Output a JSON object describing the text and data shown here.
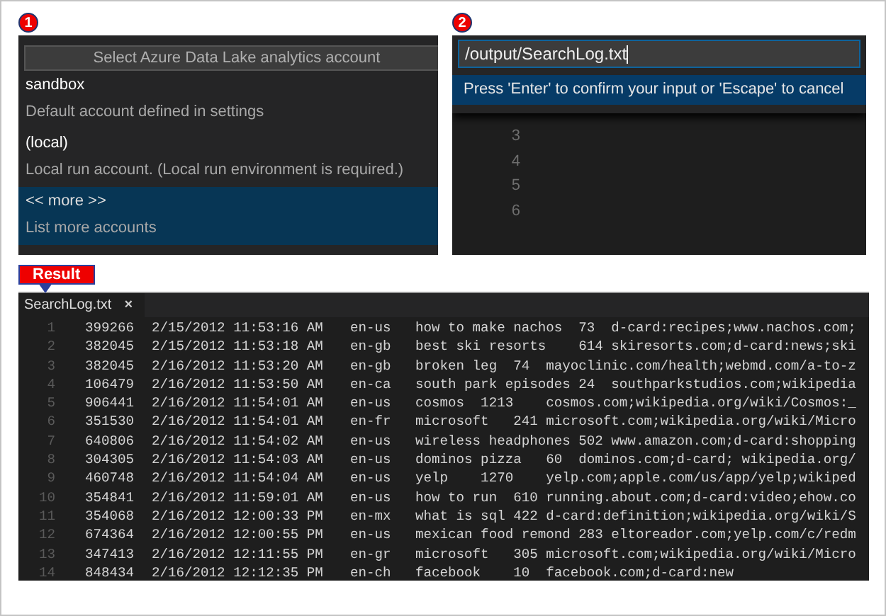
{
  "account_picker": {
    "badge": "1",
    "placeholder": "Select Azure Data Lake analytics account",
    "items": [
      {
        "name": "sandbox",
        "description": "Default account defined in settings",
        "selected": false
      },
      {
        "name": "(local)",
        "description": "Local run account. (Local run environment is required.)",
        "selected": false
      },
      {
        "name": "<< more >>",
        "description": "List more accounts",
        "selected": true
      }
    ]
  },
  "output_prompt": {
    "badge": "2",
    "value": "/output/SearchLog.txt",
    "message": "Press 'Enter' to confirm your input or 'Escape' to cancel",
    "line_numbers": [
      "3",
      "4",
      "5",
      "6"
    ]
  },
  "result": {
    "label": "Result",
    "tab": {
      "title": "SearchLog.txt",
      "close": "×"
    },
    "rows": [
      {
        "line": "1",
        "id": "399266",
        "time": "2/15/2012 11:53:16 AM",
        "locale": "en-us",
        "rest": "how to make nachos  73  d-card:recipes;www.nachos.com;"
      },
      {
        "line": "2",
        "id": "382045",
        "time": "2/15/2012 11:53:18 AM",
        "locale": "en-gb",
        "rest": "best ski resorts    614 skiresorts.com;d-card:news;ski"
      },
      {
        "line": "3",
        "id": "382045",
        "time": "2/16/2012 11:53:20 AM",
        "locale": "en-gb",
        "rest": "broken leg  74  mayoclinic.com/health;webmd.com/a-to-z"
      },
      {
        "line": "4",
        "id": "106479",
        "time": "2/16/2012 11:53:50 AM",
        "locale": "en-ca",
        "rest": "south park episodes 24  southparkstudios.com;wikipedia"
      },
      {
        "line": "5",
        "id": "906441",
        "time": "2/16/2012 11:54:01 AM",
        "locale": "en-us",
        "rest": "cosmos  1213    cosmos.com;wikipedia.org/wiki/Cosmos:_"
      },
      {
        "line": "6",
        "id": "351530",
        "time": "2/16/2012 11:54:01 AM",
        "locale": "en-fr",
        "rest": "microsoft   241 microsoft.com;wikipedia.org/wiki/Micro"
      },
      {
        "line": "7",
        "id": "640806",
        "time": "2/16/2012 11:54:02 AM",
        "locale": "en-us",
        "rest": "wireless headphones 502 www.amazon.com;d-card:shopping"
      },
      {
        "line": "8",
        "id": "304305",
        "time": "2/16/2012 11:54:03 AM",
        "locale": "en-us",
        "rest": "dominos pizza   60  dominos.com;d-card; wikipedia.org/"
      },
      {
        "line": "9",
        "id": "460748",
        "time": "2/16/2012 11:54:04 AM",
        "locale": "en-us",
        "rest": "yelp    1270    yelp.com;apple.com/us/app/yelp;wikiped"
      },
      {
        "line": "10",
        "id": "354841",
        "time": "2/16/2012 11:59:01 AM",
        "locale": "en-us",
        "rest": "how to run  610 running.about.com;d-card:video;ehow.co"
      },
      {
        "line": "11",
        "id": "354068",
        "time": "2/16/2012 12:00:33 PM",
        "locale": "en-mx",
        "rest": "what is sql 422 d-card:definition;wikipedia.org/wiki/S"
      },
      {
        "line": "12",
        "id": "674364",
        "time": "2/16/2012 12:00:55 PM",
        "locale": "en-us",
        "rest": "mexican food remond 283 eltoreador.com;yelp.com/c/redm"
      },
      {
        "line": "13",
        "id": "347413",
        "time": "2/16/2012 12:11:55 PM",
        "locale": "en-gr",
        "rest": "microsoft   305 microsoft.com;wikipedia.org/wiki/Micro"
      },
      {
        "line": "14",
        "id": "848434",
        "time": "2/16/2012 12:12:35 PM",
        "locale": "en-ch",
        "rest": "facebook    10  facebook.com;d-card:new"
      }
    ]
  }
}
